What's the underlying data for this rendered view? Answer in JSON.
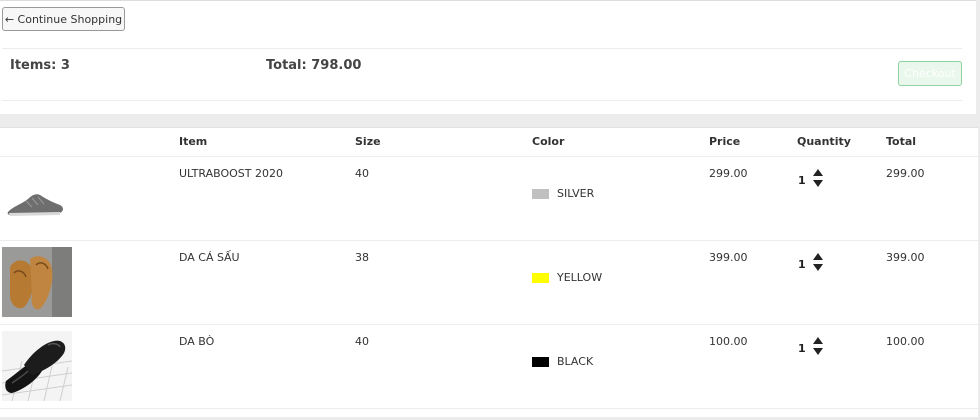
{
  "top": {
    "continue_label": "← Continue Shopping",
    "items_label": "Items: 3",
    "total_label": "Total: 798.00",
    "checkout_label": "Checkout"
  },
  "table": {
    "headers": [
      "Item",
      "Size",
      "Color",
      "Price",
      "Quantity",
      "Total"
    ],
    "rows": [
      {
        "item": "ULTRABOOST 2020",
        "size": "40",
        "color_name": "SILVER",
        "color_hex": "#c0c0c0",
        "price": "299.00",
        "quantity": "1",
        "total": "299.00",
        "image": "grey-sneaker"
      },
      {
        "item": "DA CÁ SẤU",
        "size": "38",
        "color_name": "YELLOW",
        "color_hex": "#ffff00",
        "price": "399.00",
        "quantity": "1",
        "total": "399.00",
        "image": "tan-suede-shoes"
      },
      {
        "item": "DA BÒ",
        "size": "40",
        "color_name": "BLACK",
        "color_hex": "#000000",
        "price": "100.00",
        "quantity": "1",
        "total": "100.00",
        "image": "black-leather-shoes"
      }
    ]
  }
}
